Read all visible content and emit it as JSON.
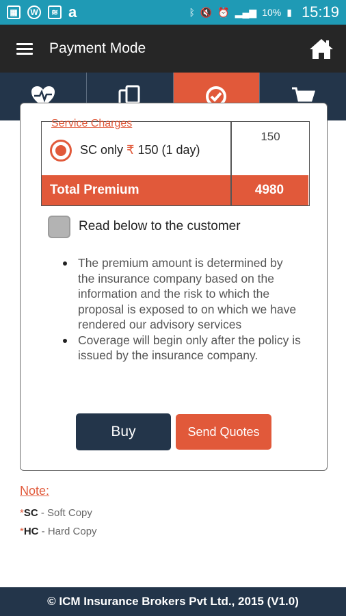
{
  "status_bar": {
    "battery": "10%",
    "time": "15:19",
    "icons": [
      "gallery-icon",
      "w-app-icon",
      "wifi-box-icon",
      "amazon-icon",
      "bluetooth-icon",
      "mute-icon",
      "alarm-icon",
      "signal-icon",
      "battery-icon"
    ]
  },
  "app_bar": {
    "title": "Payment Mode",
    "menu_icon": "hamburger-menu-icon",
    "home_icon": "home-icon"
  },
  "tabs": [
    {
      "icon": "heart-pulse-icon",
      "active": false
    },
    {
      "icon": "documents-icon",
      "active": false
    },
    {
      "icon": "check-circle-icon",
      "active": true
    },
    {
      "icon": "cart-icon",
      "active": false
    }
  ],
  "premium_table": {
    "service_charges_label": "Service Charges",
    "sc_option": {
      "prefix": "SC only ",
      "currency": "₹",
      "suffix": " 150 (1 day)",
      "selected": true
    },
    "service_value": "150",
    "total_label": "Total Premium",
    "total_value": "4980"
  },
  "confirm": {
    "checkbox_label": "Read below to the customer",
    "checked": false
  },
  "disclaimers": [
    "The premium amount is determined by the insurance company based on the information and the risk to which the proposal is exposed to on which we have rendered our advisory services",
    "Coverage will begin only after the policy is issued by the insurance company."
  ],
  "buttons": {
    "buy": "Buy",
    "send_quotes": "Send Quotes"
  },
  "note": {
    "title": "Note:",
    "items": [
      {
        "star": "*",
        "code": "SC",
        "text": " - Soft Copy"
      },
      {
        "star": "*",
        "code": "HC",
        "text": " - Hard Copy"
      }
    ]
  },
  "footer": "© ICM Insurance Brokers Pvt Ltd., 2015 (V1.0)",
  "colors": {
    "accent": "#e1593a",
    "navy": "#23354a",
    "status_bar": "#1f9ab5",
    "app_bar": "#262626"
  }
}
